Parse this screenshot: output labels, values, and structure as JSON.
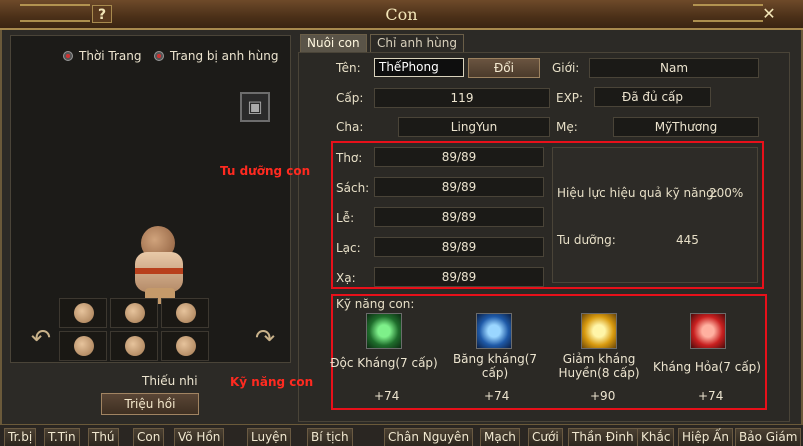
{
  "window": {
    "title": "Con",
    "help_label": "?",
    "close_label": "✕"
  },
  "left": {
    "radio_1": "Thời Trang",
    "radio_2": "Trang bị anh hùng",
    "child_label": "Thiếu nhi",
    "summon_button": "Triệu hồi"
  },
  "tabs": [
    "Nuôi con",
    "Chỉ anh hùng"
  ],
  "info": {
    "name_label": "Tên:",
    "name_value": "ThếPhong",
    "rename_button": "Đổi",
    "gender_label": "Giới:",
    "gender_value": "Nam",
    "level_label": "Cấp:",
    "level_value": "119",
    "exp_label": "EXP:",
    "exp_value": "Đã đủ cấp",
    "father_label": "Cha:",
    "father_value": "LingYun",
    "mother_label": "Mẹ:",
    "mother_value": "MỹThương"
  },
  "cultivation": {
    "section_label": "Tu dưỡng con",
    "stats": [
      {
        "label": "Thơ:",
        "value": "89/89"
      },
      {
        "label": "Sách:",
        "value": "89/89"
      },
      {
        "label": "Lễ:",
        "value": "89/89"
      },
      {
        "label": "Lạc:",
        "value": "89/89"
      },
      {
        "label": "Xạ:",
        "value": "89/89"
      }
    ],
    "effect_label": "Hiệu lực hiệu quả kỹ năng:",
    "effect_value": "200%",
    "cultivate_label": "Tu dưỡng:",
    "cultivate_value": "445"
  },
  "skills": {
    "section_label": "Kỹ năng con",
    "header": "Kỹ năng con:",
    "items": [
      {
        "name_1": "Độc Kháng(7 cấp)",
        "name_2": "",
        "bonus": "+74",
        "color": "#2e9a3a"
      },
      {
        "name_1": "Băng kháng(7",
        "name_2": "cấp)",
        "bonus": "+74",
        "color": "#2a7ad8"
      },
      {
        "name_1": "Giảm kháng",
        "name_2": "Huyền(8 cấp)",
        "bonus": "+90",
        "color": "#e0a818"
      },
      {
        "name_1": "Kháng Hỏa(7 cấp)",
        "name_2": "",
        "bonus": "+74",
        "color": "#d02a2a"
      }
    ]
  },
  "bottom_tabs": [
    "Tr.bị",
    "T.Tin",
    "Thú",
    "Con",
    "Võ Hồn",
    "Luyện",
    "Bí tịch",
    "Chân Nguyên",
    "Mạch",
    "Cưới",
    "Thần Đinh",
    "Khắc",
    "Hiệp Ấn",
    "Bảo Giám"
  ]
}
